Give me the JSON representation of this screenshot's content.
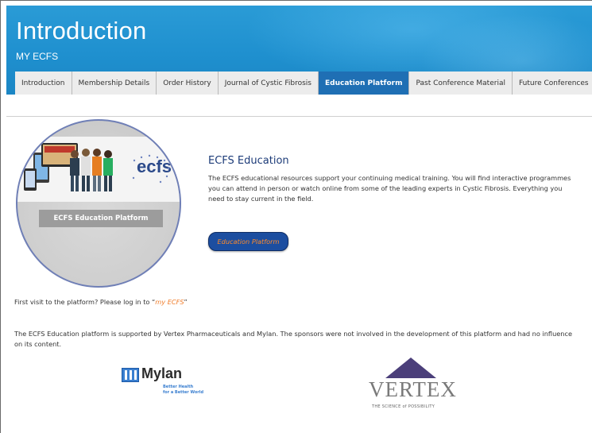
{
  "header": {
    "title": "Introduction",
    "subtitle": "MY ECFS"
  },
  "tabs": [
    {
      "label": "Introduction",
      "active": false
    },
    {
      "label": "Membership Details",
      "active": false
    },
    {
      "label": "Order History",
      "active": false
    },
    {
      "label": "Journal of Cystic Fibrosis",
      "active": false
    },
    {
      "label": "Education Platform",
      "active": true
    },
    {
      "label": "Past Conference Material",
      "active": false
    },
    {
      "label": "Future Conferences",
      "active": false
    }
  ],
  "education": {
    "circle_logo": "ecfs",
    "circle_label": "ECFS Education Platform",
    "title": "ECFS Education",
    "description": "The ECFS educational resources support your continuing medical training. You will find interactive programmes you can attend in person or watch online from some of the leading experts in Cystic Fibrosis. Everything you need to stay current in the field.",
    "button_label": "Education Platform"
  },
  "first_visit": {
    "prefix": "First visit to the platform? Please log in to “",
    "link": "my ECFS",
    "suffix": "”"
  },
  "sponsor_text": "The ECFS Education platform is supported by Vertex Pharmaceuticals and Mylan. The sponsors were not involved in the development of this platform and had no influence on its content.",
  "sponsors": {
    "mylan": {
      "name": "Mylan",
      "tagline1": "Better Health",
      "tagline2": "for a Better World"
    },
    "vertex": {
      "name": "VERTEX",
      "tagline": "THE SCIENCE of POSSIBILITY"
    }
  },
  "colors": {
    "header_blue": "#2a9bd6",
    "active_tab": "#1f6fb4",
    "button_blue": "#1c4ea0",
    "link_orange": "#f07a26"
  }
}
